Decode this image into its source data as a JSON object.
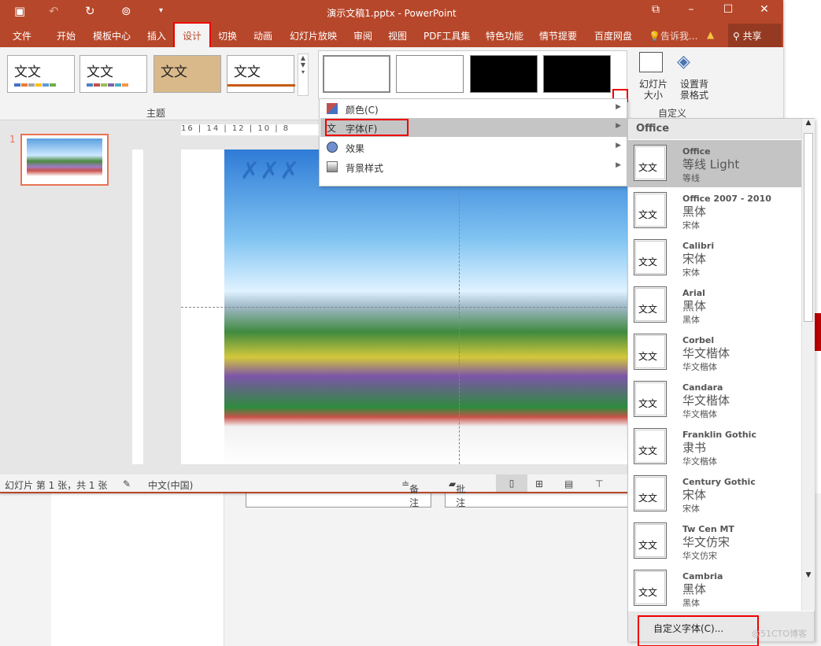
{
  "window": {
    "title": "演示文稿1.pptx - PowerPoint"
  },
  "quick_access": [
    {
      "icon": "save-icon"
    },
    {
      "icon": "undo-icon"
    },
    {
      "icon": "redo-icon"
    },
    {
      "icon": "present-icon"
    },
    {
      "icon": "customize-icon"
    }
  ],
  "tabs": [
    {
      "label": "文件"
    },
    {
      "label": "开始"
    },
    {
      "label": "模板中心"
    },
    {
      "label": "插入"
    },
    {
      "label": "设计"
    },
    {
      "label": "切换"
    },
    {
      "label": "动画"
    },
    {
      "label": "幻灯片放映"
    },
    {
      "label": "审阅"
    },
    {
      "label": "视图"
    },
    {
      "label": "PDF工具集"
    },
    {
      "label": "特色功能"
    },
    {
      "label": "情节提要"
    },
    {
      "label": "百度网盘"
    }
  ],
  "active_tab": "设计",
  "tell_me": "告诉我...",
  "share": "共享",
  "ribbon": {
    "themes_group": "主题",
    "theme_sample": "文文",
    "custom_group": "自定义",
    "slide_size": "幻灯片大小",
    "slide_size_arrow": "▾",
    "bg_format": "设置背景格式"
  },
  "ruler": "16 | 14 | 12 | 10 | 8",
  "slides": {
    "number": "1"
  },
  "menu": {
    "items": [
      {
        "label": "颜色(C)",
        "icon": "colors-icon"
      },
      {
        "label": "字体(F)",
        "icon": "fonts-icon",
        "selected": true
      },
      {
        "label": "效果",
        "icon": "effects-icon"
      },
      {
        "label": "背景样式",
        "icon": "background-style-icon"
      }
    ]
  },
  "fonts": {
    "header": "Office",
    "items": [
      {
        "name": "Office",
        "heading": "等线 Light",
        "body": "等线",
        "selected": true
      },
      {
        "name": "Office 2007 - 2010",
        "heading": "黑体",
        "body": "宋体"
      },
      {
        "name": "Calibri",
        "heading": "宋体",
        "body": "宋体"
      },
      {
        "name": "Arial",
        "heading": "黑体",
        "body": "黑体"
      },
      {
        "name": "Corbel",
        "heading": "华文楷体",
        "body": "华文楷体"
      },
      {
        "name": "Candara",
        "heading": "华文楷体",
        "body": "华文楷体"
      },
      {
        "name": "Franklin Gothic",
        "heading": "隶书",
        "body": "华文楷体"
      },
      {
        "name": "Century Gothic",
        "heading": "宋体",
        "body": "宋体"
      },
      {
        "name": "Tw Cen MT",
        "heading": "华文仿宋",
        "body": "华文仿宋"
      },
      {
        "name": "Cambria",
        "heading": "黑体",
        "body": "黑体"
      }
    ],
    "preview": "文文",
    "custom": "自定义字体(C)..."
  },
  "status": {
    "slide_info": "幻灯片 第 1 张，共 1 张",
    "language": "中文(中国)",
    "notes": "备注",
    "comments": "批注"
  },
  "watermark": "@51CTO博客",
  "colors": {
    "accent": "#b7472a",
    "highlight": "#e00000"
  }
}
